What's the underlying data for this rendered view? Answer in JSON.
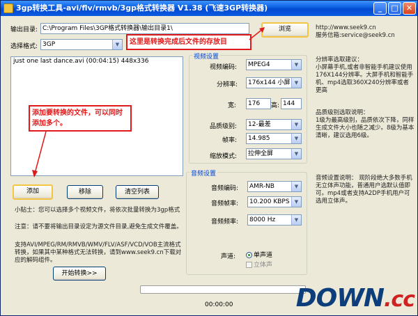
{
  "window": {
    "title": "3gp转换工具-avi/flv/rmvb/3gp格式转换器 V1.38 (飞速3GP转换器)",
    "minimize": "_",
    "maximize": "□",
    "close": "✕"
  },
  "output": {
    "label": "输出目录:",
    "value": "C:\\Program Files\\3GP格式转换器\\输出目录1\\",
    "browse_button": "浏览"
  },
  "format": {
    "label": "选择格式:",
    "value": "3GP"
  },
  "file_list": {
    "items": [
      "just one last dance.avi (00:04:15) 448x336"
    ]
  },
  "video_settings": {
    "title": "视频设置",
    "codec_label": "视频编码:",
    "codec_value": "MPEG4",
    "resolution_label": "分辨率:",
    "resolution_value": "176x144 小屏",
    "width_label": "宽:",
    "width_value": "176",
    "height_label": "高:",
    "height_value": "144",
    "quality_label": "品质级别:",
    "quality_value": "12-最差",
    "framerate_label": "帧率:",
    "framerate_value": "14.985",
    "scale_label": "缩放模式:",
    "scale_value": "拉伸全屏"
  },
  "audio_settings": {
    "title": "音频设置",
    "codec_label": "音频编码:",
    "codec_value": "AMR-NB",
    "bitrate_label": "音频帧率:",
    "bitrate_value": "10.200 KBPS",
    "samplerate_label": "音频频率:",
    "samplerate_value": "8000 Hz",
    "channel_label": "声道:",
    "mono_label": "单声道",
    "stereo_label": "立体声"
  },
  "buttons": {
    "add": "添加",
    "remove": "移除",
    "clear": "清空列表",
    "start": "开始转换>>"
  },
  "tips": {
    "line1": "小贴士：您可以选择多个视频文件，将依次批量转换为3gp格式",
    "line2": "注意：请不要将输出目录设定为源文件目录,避免生成文件覆盖。",
    "line3": "支持AVI/MPEG/RM/RMVB/WMV/FLV/ASF/VCD/VOB主流格式转换，如果其中某种格式无法转换，请到www.seek9.cn下载对应的解码组件。"
  },
  "contact": {
    "url": "http://www.seek9.cn",
    "email": "服务信箱:service@seek9.cn"
  },
  "help": {
    "resolution": "分辨率选取建议：\n小屏幕手机,或者非智能手机建议使用176X144分辨率。大屏手机和智能手机、mp4选取360X240分辨率或者更高",
    "quality": "品质级别选取说明：\n1级为最高级别，品质依次下降，同样生成文件大小也随之减少。8级为基本清晰，建议选用6级。",
    "audio": "音频设置说明：  现阶段绝大多数手机无立体声功能，普通用户选默认值即可。mp4或者支持A2DP手机用户可选用立体声。"
  },
  "status": {
    "time": "00:00:00",
    "progress": 0
  },
  "annotations": {
    "output_note": "这里是转换完成后文件的存放目",
    "add_note": "添加要转换的文件，可以同时添加多个。"
  },
  "watermark": {
    "text": "DOWN",
    "suffix": ".cc"
  },
  "colors": {
    "annotation_red": "#e01a1a",
    "titlebar_blue": "#0a5ce0",
    "group_title_blue": "#0046d5"
  }
}
